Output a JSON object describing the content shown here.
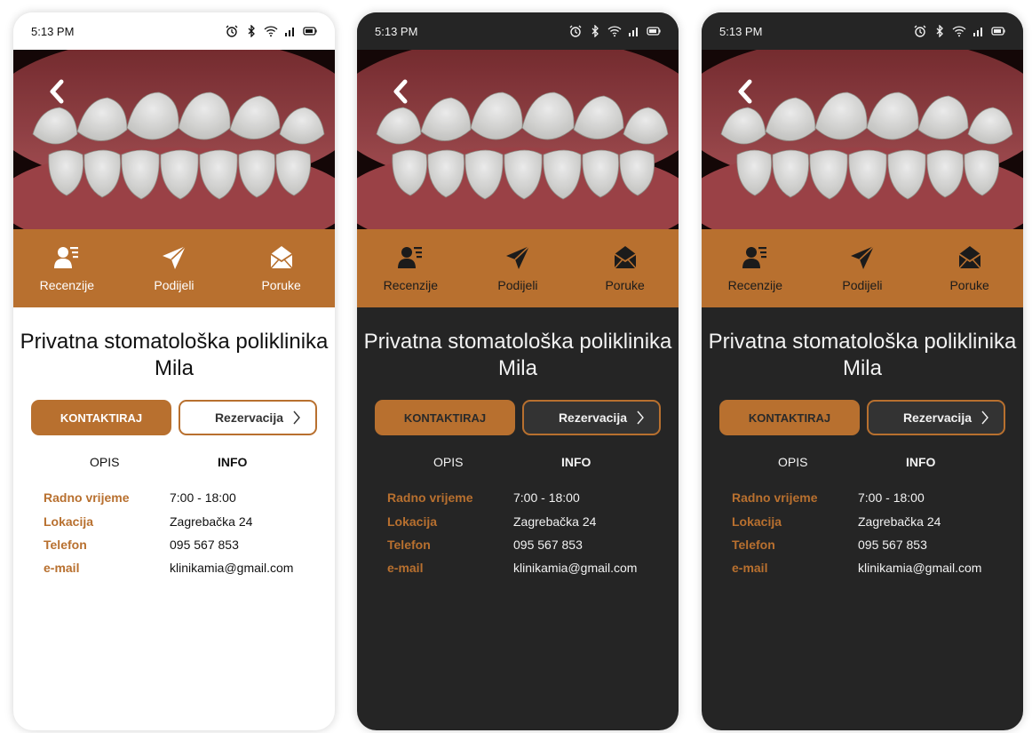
{
  "status_bar": {
    "time": "5:13 PM"
  },
  "actions": [
    {
      "label": "Recenzije",
      "icon": "user-review-icon"
    },
    {
      "label": "Podijeli",
      "icon": "send-icon"
    },
    {
      "label": "Poruke",
      "icon": "mail-icon"
    }
  ],
  "clinic": {
    "title": "Privatna stomatološka poliklinika Mila"
  },
  "buttons": {
    "contact": "KONTAKTIRAJ",
    "reservation": "Rezervacija"
  },
  "tabs": {
    "opis": "OPIS",
    "info": "INFO"
  },
  "info": [
    {
      "key": "Radno vrijeme",
      "value": "7:00 - 18:00"
    },
    {
      "key": "Lokacija",
      "value": "Zagrebačka 24"
    },
    {
      "key": "Telefon",
      "value": "095 567 853"
    },
    {
      "key": "e-mail",
      "value": "klinikamia@gmail.com"
    }
  ],
  "themes": [
    "light",
    "dark",
    "dark"
  ],
  "colors": {
    "accent": "#b8702f",
    "dark_bg": "#252525",
    "light_bg": "#ffffff"
  }
}
